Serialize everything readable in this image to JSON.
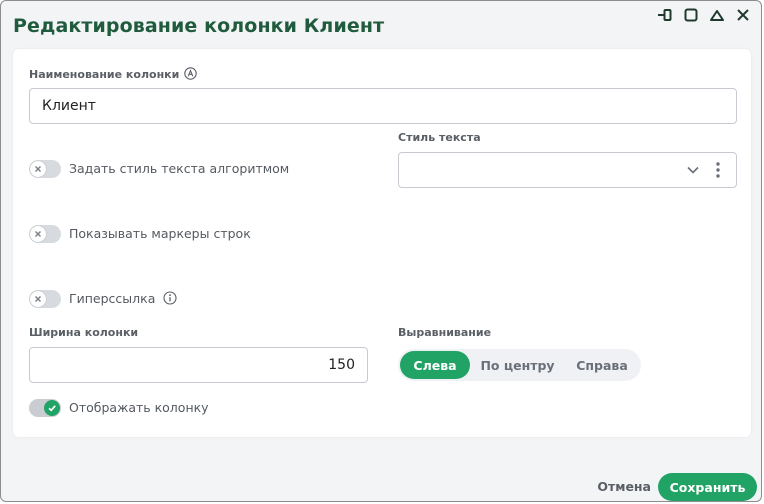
{
  "dialog": {
    "title": "Редактирование колонки Клиент"
  },
  "window_controls": {
    "icons": [
      "pin-icon",
      "maximize-icon",
      "collapse-icon",
      "close-icon"
    ]
  },
  "column_name": {
    "label": "Наименование колонки",
    "value": "Клиент"
  },
  "text_style_algorithm": {
    "label": "Задать стиль текста алгоритмом",
    "enabled": false
  },
  "text_style": {
    "label": "Стиль текста",
    "value": ""
  },
  "show_row_markers": {
    "label": "Показывать маркеры строк",
    "enabled": false
  },
  "hyperlink": {
    "label": "Гиперссылка",
    "enabled": false
  },
  "column_width": {
    "label": "Ширина колонки",
    "value": "150"
  },
  "alignment": {
    "label": "Выравнивание",
    "options": [
      "Слева",
      "По центру",
      "Справа"
    ],
    "selected": "Слева"
  },
  "show_column": {
    "label": "Отображать колонку",
    "enabled": true
  },
  "footer": {
    "cancel_label": "Отмена",
    "save_label": "Сохранить"
  },
  "colors": {
    "accent": "#21a366",
    "title": "#1f5b3c"
  }
}
